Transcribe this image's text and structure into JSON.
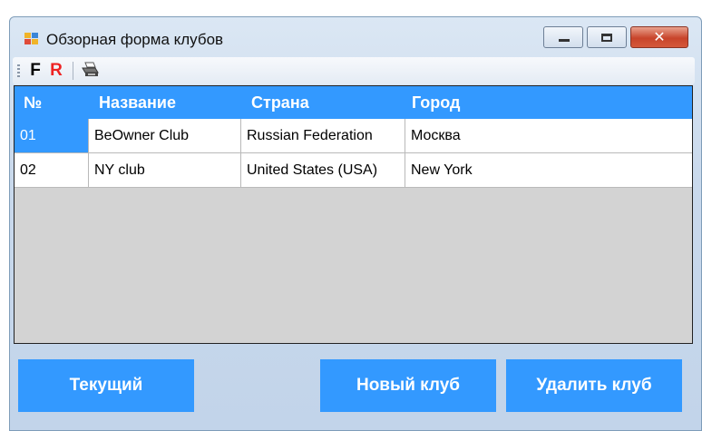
{
  "window": {
    "title": "Обзорная форма клубов",
    "close_glyph": "✕"
  },
  "toolbar": {
    "f_label": "F",
    "r_label": "R",
    "print_icon": "printer-icon"
  },
  "grid": {
    "columns": [
      "№",
      "Название",
      "Страна",
      "Город"
    ],
    "rows": [
      {
        "num": "01",
        "name": "BeOwner Club",
        "country": "Russian Federation",
        "city": "Москва"
      },
      {
        "num": "02",
        "name": "NY club",
        "country": "United States (USA)",
        "city": "New York"
      }
    ],
    "selected_row": 0
  },
  "buttons": {
    "current": "Текущий",
    "new_club": "Новый клуб",
    "delete_club": "Удалить клуб"
  },
  "colors": {
    "accent": "#3399ff",
    "grid_background": "#d3d3d3"
  }
}
